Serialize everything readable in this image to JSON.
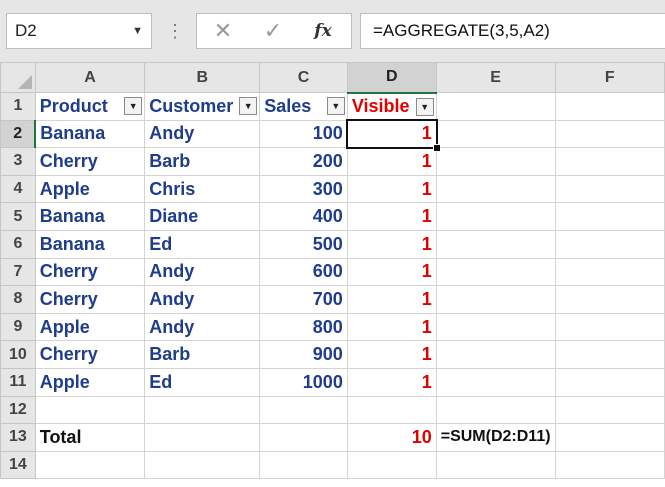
{
  "formula_bar": {
    "name_box": "D2",
    "formula": "=AGGREGATE(3,5,A2)"
  },
  "columns": [
    "A",
    "B",
    "C",
    "D",
    "E",
    "F"
  ],
  "selected_column": "D",
  "header_row": {
    "row_num": "1",
    "product": "Product",
    "customer": "Customer",
    "sales": "Sales",
    "visible": "Visible"
  },
  "rows": [
    {
      "n": "2",
      "product": "Banana",
      "customer": "Andy",
      "sales": "100",
      "visible": "1"
    },
    {
      "n": "3",
      "product": "Cherry",
      "customer": "Barb",
      "sales": "200",
      "visible": "1"
    },
    {
      "n": "4",
      "product": "Apple",
      "customer": "Chris",
      "sales": "300",
      "visible": "1"
    },
    {
      "n": "5",
      "product": "Banana",
      "customer": "Diane",
      "sales": "400",
      "visible": "1"
    },
    {
      "n": "6",
      "product": "Banana",
      "customer": "Ed",
      "sales": "500",
      "visible": "1"
    },
    {
      "n": "7",
      "product": "Cherry",
      "customer": "Andy",
      "sales": "600",
      "visible": "1"
    },
    {
      "n": "8",
      "product": "Cherry",
      "customer": "Andy",
      "sales": "700",
      "visible": "1"
    },
    {
      "n": "9",
      "product": "Apple",
      "customer": "Andy",
      "sales": "800",
      "visible": "1"
    },
    {
      "n": "10",
      "product": "Cherry",
      "customer": "Barb",
      "sales": "900",
      "visible": "1"
    },
    {
      "n": "11",
      "product": "Apple",
      "customer": "Ed",
      "sales": "1000",
      "visible": "1"
    }
  ],
  "row12": {
    "n": "12"
  },
  "total_row": {
    "n": "13",
    "label": "Total",
    "value": "10",
    "note": "=SUM(D2:D11)"
  },
  "row14": {
    "n": "14"
  },
  "colors": {
    "header_bg": "#e6e6e6",
    "data_text": "#1f3d8c",
    "visible_text": "#e00000",
    "selection": "#217346"
  },
  "icons": [
    "cancel-icon",
    "enter-check-icon",
    "insert-function-icon",
    "dropdown-arrow-icon",
    "filter-dropdown-icon",
    "select-all-icon"
  ]
}
